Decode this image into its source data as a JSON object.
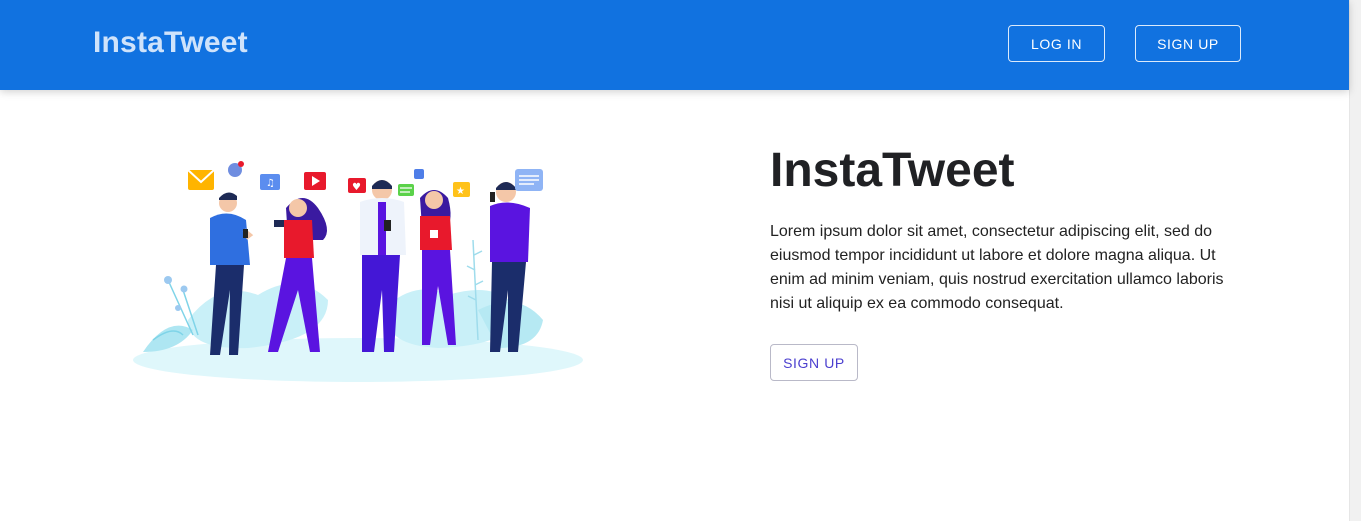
{
  "header": {
    "brand": "InstaTweet",
    "login_label": "LOG IN",
    "signup_label": "SIGN UP"
  },
  "hero": {
    "title": "InstaTweet",
    "description": "Lorem ipsum dolor sit amet, consectetur adipiscing elit, sed do eiusmod tempor incididunt ut labore et dolore magna aliqua. Ut enim ad minim veniam, quis nostrud exercitation ullamco laboris nisi ut aliquip ex ea commodo consequat.",
    "cta_label": "SIGN UP"
  },
  "illustration": {
    "icon": "social-media-people-illustration"
  },
  "colors": {
    "appbar": "#1172e0",
    "brand_text": "#cfe3fb",
    "cta_text": "#4b3fcf"
  }
}
